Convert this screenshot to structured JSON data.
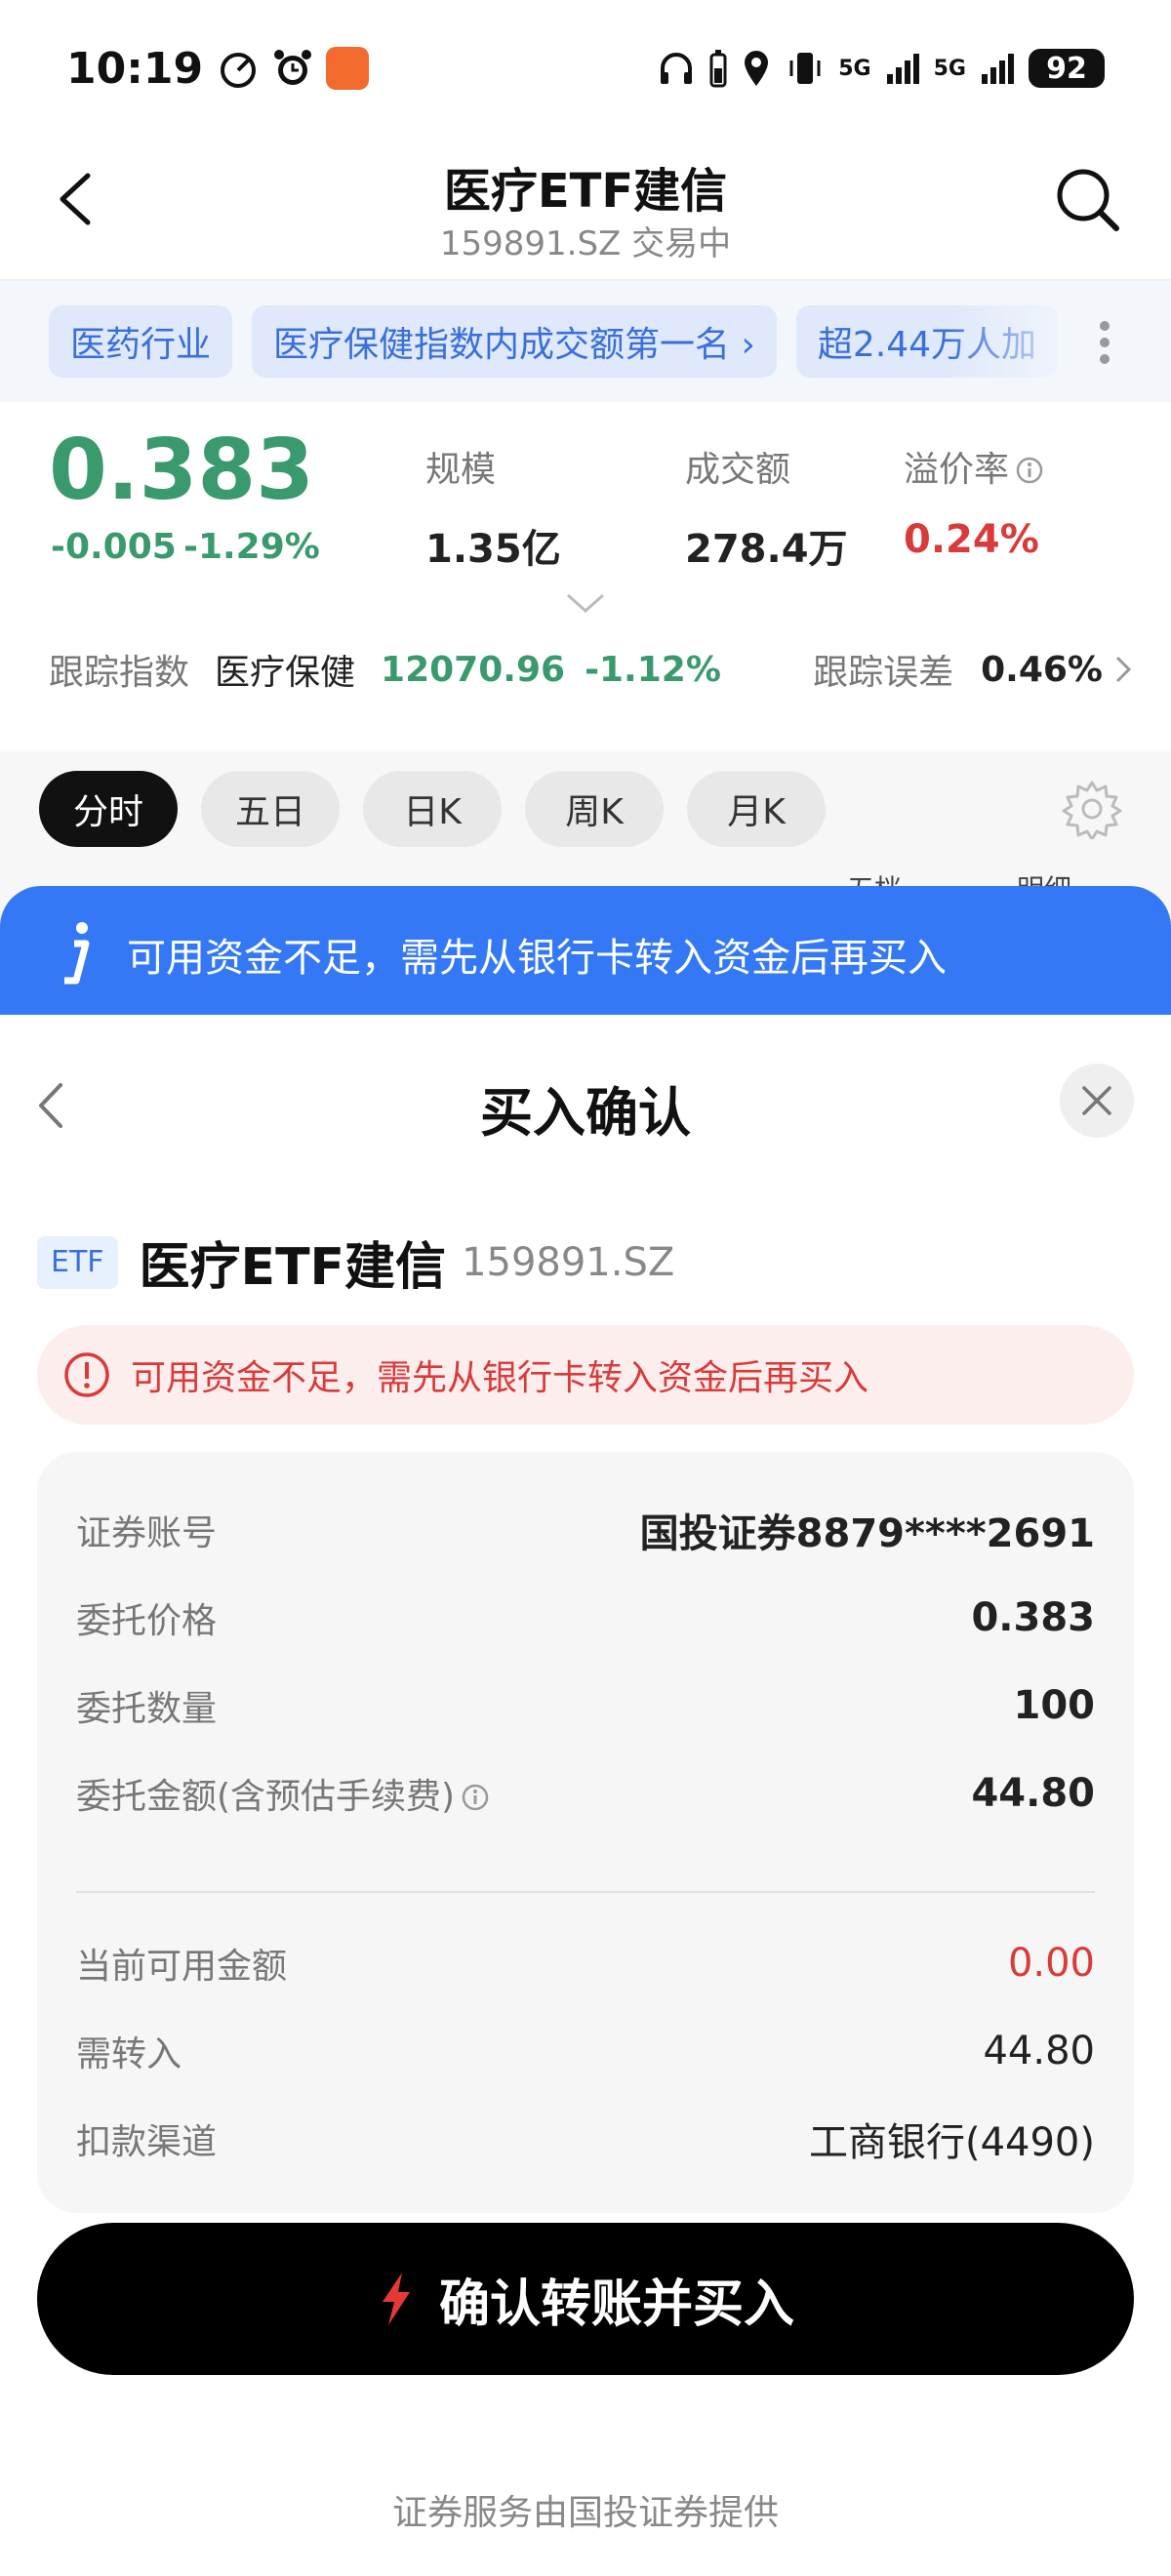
{
  "status_bar": {
    "time": "10:19",
    "network_1": "5G",
    "network_2": "5G",
    "battery": "92"
  },
  "nav": {
    "title": "医疗ETF建信",
    "subtitle": "159891.SZ 交易中"
  },
  "tags": [
    "医药行业",
    "医疗保健指数内成交额第一名 ›",
    "超2.44万人加"
  ],
  "quote": {
    "price": "0.383",
    "change": "-0.005",
    "change_pct": "-1.29%",
    "stats": [
      {
        "label": "规模",
        "value": "1.35亿"
      },
      {
        "label": "成交额",
        "value": "278.4万"
      },
      {
        "label": "溢价率",
        "value": "0.24%"
      }
    ],
    "tracking": {
      "label": "跟踪指数",
      "index_name": "医疗保健",
      "index_value": "12070.96",
      "index_pct": "-1.12%",
      "error_label": "跟踪误差",
      "error_value": "0.46%"
    }
  },
  "chart_tabs": [
    "分时",
    "五日",
    "日K",
    "周K",
    "月K"
  ],
  "chart_tabs_peek": [
    "五档",
    "明细"
  ],
  "banner": {
    "text": "可用资金不足，需先从银行卡转入资金后再买入"
  },
  "sheet": {
    "title": "买入确认",
    "security": {
      "badge": "ETF",
      "name": "医疗ETF建信",
      "code": "159891.SZ"
    },
    "warning": "可用资金不足，需先从银行卡转入资金后再买入",
    "details": [
      {
        "label": "证券账号",
        "value": "国投证券8879****2691"
      },
      {
        "label": "委托价格",
        "value": "0.383"
      },
      {
        "label": "委托数量",
        "value": "100"
      },
      {
        "label": "委托金额(含预估手续费)",
        "value": "44.80"
      },
      {
        "label": "当前可用金额",
        "value": "0.00"
      },
      {
        "label": "需转入",
        "value": "44.80"
      },
      {
        "label": "扣款渠道",
        "value": "工商银行(4490)"
      }
    ],
    "cta": "确认转账并买入",
    "footer": "证券服务由国投证券提供"
  },
  "colors": {
    "down_green": "#3a9a6e",
    "up_red": "#d93a3a",
    "accent_blue": "#3478f6",
    "tag_blue": "#3a6fd9"
  }
}
